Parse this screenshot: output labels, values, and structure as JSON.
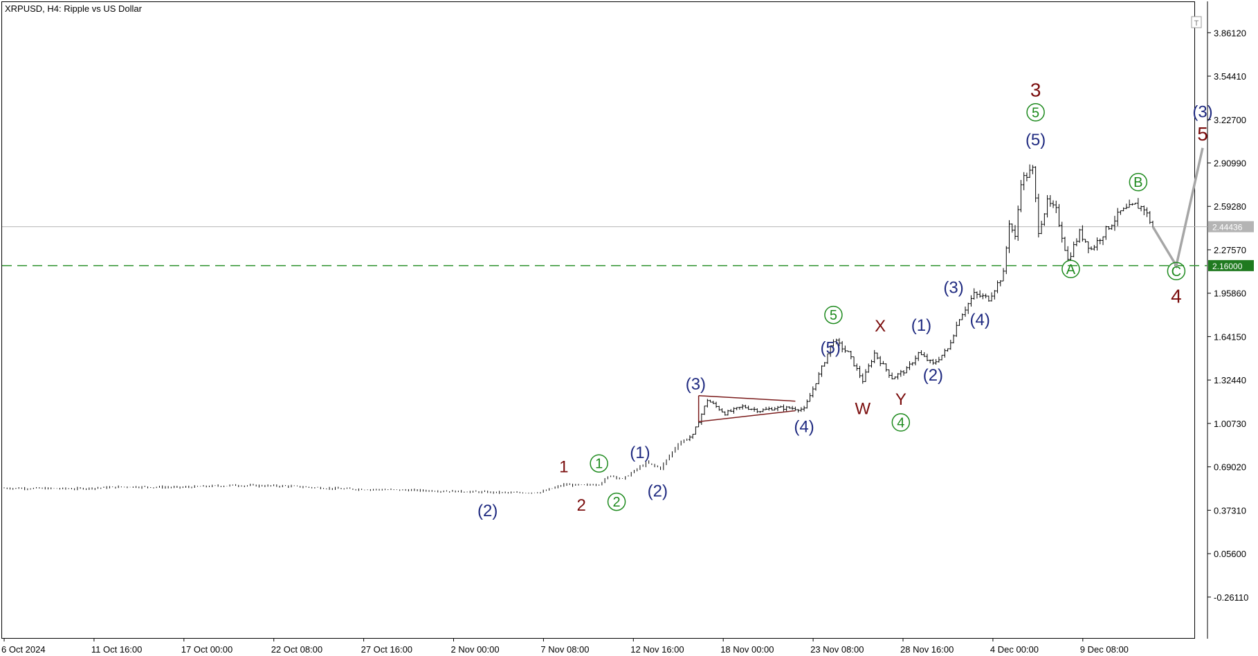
{
  "window": {
    "symbol_title": "XRPUSD, H4:  Ripple vs US Dollar",
    "corner_icon": "T"
  },
  "colors": {
    "navy": "#1f2a80",
    "dark_red": "#7a0c0c",
    "green": "#1d8a1d",
    "projection_gray": "#a6a6a6",
    "target_line_green": "#3c9a3c",
    "current_price_line": "#b4b4b4",
    "triangle_red": "#7a1a1a",
    "candles": "#000000"
  },
  "chart_data": {
    "type": "candlestick",
    "title": "XRPUSD, H4:  Ripple vs US Dollar",
    "y_ticks": [
      "3.86120",
      "3.54410",
      "3.22700",
      "2.90990",
      "2.59280",
      "2.27570",
      "1.95860",
      "1.64150",
      "1.32440",
      "1.00730",
      "0.69020",
      "0.37310",
      "0.05600",
      "-0.26110"
    ],
    "y_range": [
      -0.55,
      4.08
    ],
    "x_tick_labels": [
      "6 Oct 2024",
      "11 Oct 16:00",
      "17 Oct 00:00",
      "22 Oct 08:00",
      "27 Oct 16:00",
      "2 Nov 00:00",
      "7 Nov 08:00",
      "12 Nov 16:00",
      "18 Nov 00:00",
      "23 Nov 08:00",
      "28 Nov 16:00",
      "4 Dec 00:00",
      "9 Dec 08:00"
    ],
    "x_start": "2024-10-06 00:00",
    "bar_interval_hours": 4,
    "x_end": "2024-12-13 04:00",
    "current_price": {
      "value": 2.44436,
      "label": "2.44436"
    },
    "target_level": {
      "value": 2.16,
      "label": "2.16000"
    },
    "price_path": [
      [
        "2024-10-06 00:00",
        0.535
      ],
      [
        "2024-10-10 00:00",
        0.53
      ],
      [
        "2024-10-13 00:00",
        0.545
      ],
      [
        "2024-10-16 00:00",
        0.54
      ],
      [
        "2024-10-19 00:00",
        0.555
      ],
      [
        "2024-10-22 00:00",
        0.55
      ],
      [
        "2024-10-25 00:00",
        0.53
      ],
      [
        "2024-10-29 00:00",
        0.52
      ],
      [
        "2024-11-01 00:00",
        0.51
      ],
      [
        "2024-11-04 00:00",
        0.5
      ],
      [
        "2024-11-05 12:00",
        0.505
      ],
      [
        "2024-11-06 20:00",
        0.56
      ],
      [
        "2024-11-08 00:00",
        0.555
      ],
      [
        "2024-11-08 20:00",
        0.565
      ],
      [
        "2024-11-09 12:00",
        0.63
      ],
      [
        "2024-11-10 04:00",
        0.6
      ],
      [
        "2024-11-11 12:00",
        0.72
      ],
      [
        "2024-11-12 08:00",
        0.68
      ],
      [
        "2024-11-13 08:00",
        0.86
      ],
      [
        "2024-11-14 04:00",
        0.92
      ],
      [
        "2024-11-15 00:00",
        1.18
      ],
      [
        "2024-11-16 00:00",
        1.08
      ],
      [
        "2024-11-17 00:00",
        1.13
      ],
      [
        "2024-11-18 00:00",
        1.1
      ],
      [
        "2024-11-18 20:00",
        1.12
      ],
      [
        "2024-11-19 16:00",
        1.12
      ],
      [
        "2024-11-20 12:00",
        1.11
      ],
      [
        "2024-11-21 08:00",
        1.36
      ],
      [
        "2024-11-22 04:00",
        1.62
      ],
      [
        "2024-11-23 00:00",
        1.52
      ],
      [
        "2024-11-23 20:00",
        1.32
      ],
      [
        "2024-11-24 12:00",
        1.52
      ],
      [
        "2024-11-25 12:00",
        1.34
      ],
      [
        "2024-11-26 08:00",
        1.4
      ],
      [
        "2024-11-27 00:00",
        1.52
      ],
      [
        "2024-11-27 20:00",
        1.44
      ],
      [
        "2024-11-28 16:00",
        1.55
      ],
      [
        "2024-11-29 08:00",
        1.78
      ],
      [
        "2024-11-30 04:00",
        1.95
      ],
      [
        "2024-12-01 00:00",
        1.92
      ],
      [
        "2024-12-01 20:00",
        2.1
      ],
      [
        "2024-12-02 04:00",
        2.48
      ],
      [
        "2024-12-02 12:00",
        2.36
      ],
      [
        "2024-12-02 20:00",
        2.78
      ],
      [
        "2024-12-03 12:00",
        2.86
      ],
      [
        "2024-12-03 20:00",
        2.42
      ],
      [
        "2024-12-04 08:00",
        2.62
      ],
      [
        "2024-12-04 20:00",
        2.56
      ],
      [
        "2024-12-05 12:00",
        2.2
      ],
      [
        "2024-12-06 04:00",
        2.4
      ],
      [
        "2024-12-06 20:00",
        2.28
      ],
      [
        "2024-12-07 16:00",
        2.42
      ],
      [
        "2024-12-08 12:00",
        2.55
      ],
      [
        "2024-12-09 08:00",
        2.6
      ],
      [
        "2024-12-09 20:00",
        2.58
      ],
      [
        "2024-12-10 08:00",
        2.44
      ]
    ],
    "projection_path": [
      [
        "2024-12-10 08:00",
        2.44436
      ],
      [
        "2024-12-11 16:00",
        2.16
      ],
      [
        "2024-12-13 04:00",
        3.02
      ]
    ],
    "triangle": {
      "upper": [
        [
          "2024-11-14 12:00",
          1.21
        ],
        [
          "2024-11-20 00:00",
          1.17
        ]
      ],
      "lower": [
        [
          "2024-11-14 12:00",
          1.02
        ],
        [
          "2024-11-20 00:00",
          1.1
        ]
      ]
    },
    "wave_labels": [
      {
        "text": "(2)",
        "style": "navy",
        "t": "2024-11-02 12:00",
        "v": 0.375
      },
      {
        "text": "1",
        "style": "red",
        "t": "2024-11-06 20:00",
        "v": 0.695
      },
      {
        "text": "2",
        "style": "red",
        "t": "2024-11-07 20:00",
        "v": 0.415
      },
      {
        "text": "1",
        "style": "green-circle",
        "t": "2024-11-08 20:00",
        "v": 0.715
      },
      {
        "text": "2",
        "style": "green-circle",
        "t": "2024-11-09 20:00",
        "v": 0.435
      },
      {
        "text": "(1)",
        "style": "navy",
        "t": "2024-11-11 04:00",
        "v": 0.8
      },
      {
        "text": "(2)",
        "style": "navy",
        "t": "2024-11-12 04:00",
        "v": 0.52
      },
      {
        "text": "(3)",
        "style": "navy",
        "t": "2024-11-14 08:00",
        "v": 1.3
      },
      {
        "text": "(4)",
        "style": "navy",
        "t": "2024-11-20 12:00",
        "v": 0.99
      },
      {
        "text": "5",
        "style": "green-circle",
        "t": "2024-11-22 04:00",
        "v": 1.8
      },
      {
        "text": "(5)",
        "style": "navy",
        "t": "2024-11-22 00:00",
        "v": 1.565
      },
      {
        "text": "W",
        "style": "red",
        "t": "2024-11-23 20:00",
        "v": 1.12
      },
      {
        "text": "X",
        "style": "red",
        "t": "2024-11-24 20:00",
        "v": 1.725
      },
      {
        "text": "Y",
        "style": "red",
        "t": "2024-11-26 00:00",
        "v": 1.19
      },
      {
        "text": "4",
        "style": "green-circle",
        "t": "2024-11-26 00:00",
        "v": 1.015
      },
      {
        "text": "(1)",
        "style": "navy",
        "t": "2024-11-27 04:00",
        "v": 1.73
      },
      {
        "text": "(2)",
        "style": "navy",
        "t": "2024-11-27 20:00",
        "v": 1.365
      },
      {
        "text": "(3)",
        "style": "navy",
        "t": "2024-11-29 00:00",
        "v": 2.005
      },
      {
        "text": "(4)",
        "style": "navy",
        "t": "2024-11-30 12:00",
        "v": 1.77
      },
      {
        "text": "3",
        "style": "red-big",
        "t": "2024-12-03 16:00",
        "v": 3.44
      },
      {
        "text": "5",
        "style": "green-circle",
        "t": "2024-12-03 16:00",
        "v": 3.28
      },
      {
        "text": "(5)",
        "style": "navy",
        "t": "2024-12-03 16:00",
        "v": 3.085
      },
      {
        "text": "A",
        "style": "green-circle",
        "t": "2024-12-05 16:00",
        "v": 2.135
      },
      {
        "text": "B",
        "style": "green-circle",
        "t": "2024-12-09 12:00",
        "v": 2.77
      },
      {
        "text": "C",
        "style": "green-circle",
        "t": "2024-12-11 16:00",
        "v": 2.12
      },
      {
        "text": "4",
        "style": "red-big",
        "t": "2024-12-11 16:00",
        "v": 1.935
      },
      {
        "text": "(3)",
        "style": "navy",
        "t": "2024-12-13 04:00",
        "v": 3.29
      },
      {
        "text": "5",
        "style": "red-big",
        "t": "2024-12-13 04:00",
        "v": 3.12
      }
    ]
  }
}
